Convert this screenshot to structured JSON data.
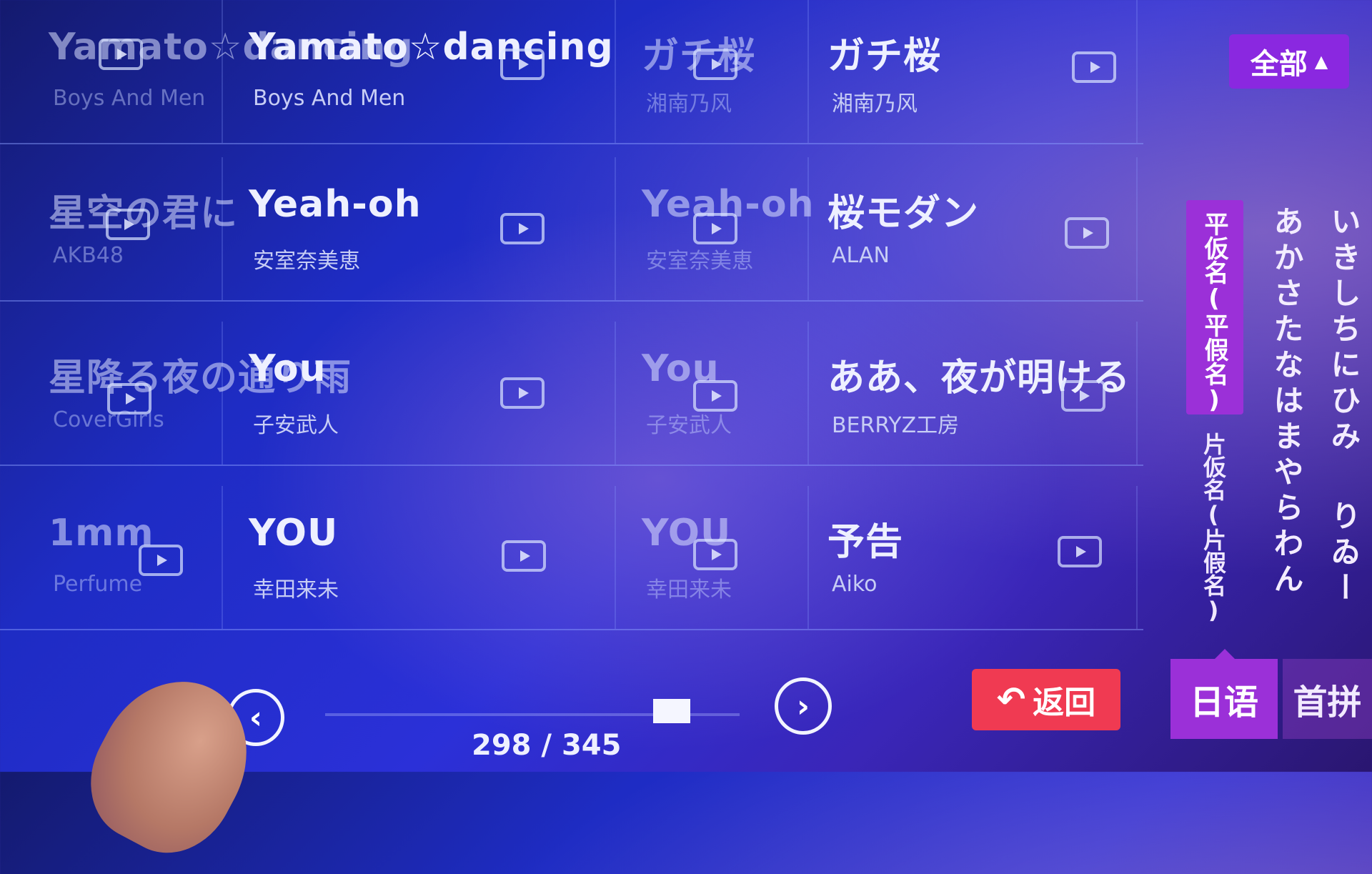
{
  "songs": [
    [
      {
        "title": "Yamato☆dancing",
        "artist": "Boys And Men"
      },
      {
        "title": "Yamato☆dancing",
        "artist": "Boys And Men"
      },
      {
        "title": "ガチ桜",
        "artist": "湘南乃风"
      },
      {
        "title": "ガチ桜",
        "artist": "湘南乃风"
      }
    ],
    [
      {
        "title": "星空の君に",
        "artist": "AKB48"
      },
      {
        "title": "Yeah-oh",
        "artist": "安室奈美恵"
      },
      {
        "title": "Yeah-oh",
        "artist": "安室奈美恵"
      },
      {
        "title": "桜モダン",
        "artist": "ALAN"
      }
    ],
    [
      {
        "title": "星降る夜の通り雨",
        "artist": "CoverGirls"
      },
      {
        "title": "You",
        "artist": "子安武人"
      },
      {
        "title": "You",
        "artist": "子安武人"
      },
      {
        "title": "ああ、夜が明ける",
        "artist": "BERRYZ工房"
      }
    ],
    [
      {
        "title": "1mm",
        "artist": "Perfume"
      },
      {
        "title": "YOU",
        "artist": "幸田来未"
      },
      {
        "title": "YOU",
        "artist": "幸田来未"
      },
      {
        "title": "予告",
        "artist": "Aiko"
      }
    ]
  ],
  "filter": {
    "all_label": "全部"
  },
  "kana_index": {
    "hiragana_label": "平仮名(平假名)",
    "katakana_label": "片仮名(片假名)",
    "col_a": "あかさたなはまやらわん",
    "col_i": "いきしちにひみ",
    "col_extra": "りゐー"
  },
  "language_tabs": {
    "japanese": "日语",
    "initials": "首拼"
  },
  "pagination": {
    "current": 298,
    "total": 345,
    "text": "298 / 345"
  },
  "back_label": "返回",
  "icons": {
    "play": "play-icon",
    "prev": "chevron-left-icon",
    "next": "chevron-right-icon",
    "back": "back-arrow-icon"
  }
}
